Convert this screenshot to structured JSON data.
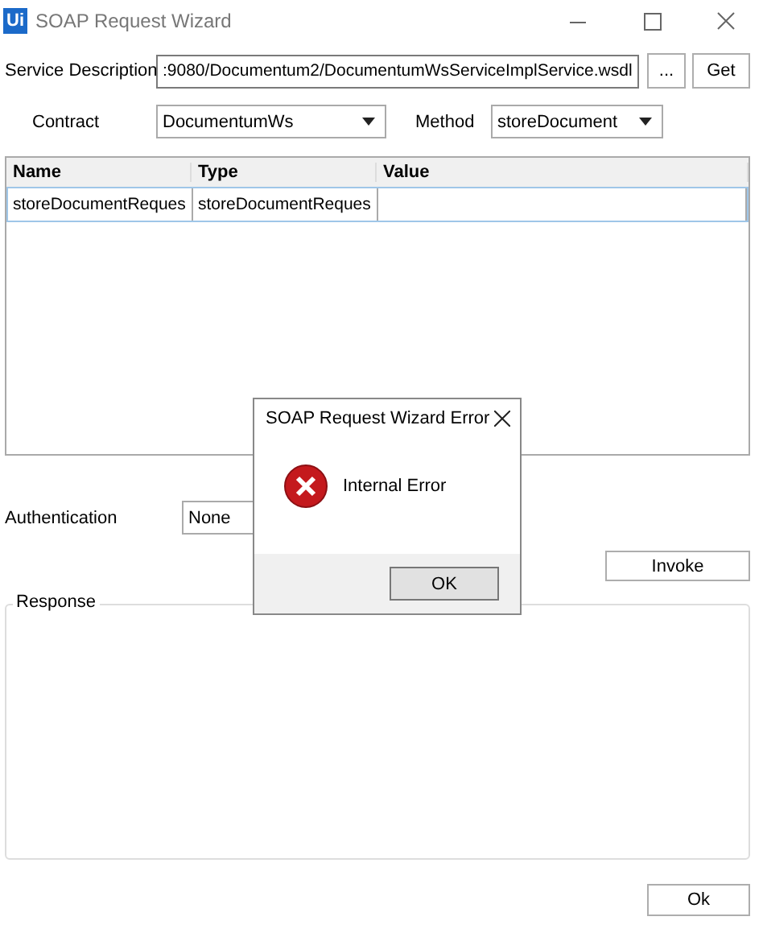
{
  "window": {
    "logo": "Ui",
    "title": "SOAP Request Wizard"
  },
  "service": {
    "label": "Service Description",
    "value": ":9080/Documentum2/DocumentumWsServiceImplService.wsdl",
    "browse": "...",
    "get": "Get"
  },
  "contract": {
    "label": "Contract",
    "value": "DocumentumWs"
  },
  "method": {
    "label": "Method",
    "value": "storeDocument"
  },
  "table": {
    "columns": [
      "Name",
      "Type",
      "Value"
    ],
    "rows": [
      {
        "cells": [
          "storeDocumentReques",
          "storeDocumentReques",
          ""
        ],
        "selected": true
      }
    ]
  },
  "authentication": {
    "label": "Authentication",
    "value": "None"
  },
  "invoke": "Invoke",
  "response": {
    "label": "Response"
  },
  "ok": "Ok",
  "dialog": {
    "title": "SOAP Request Wizard Error",
    "message": "Internal Error",
    "button": "OK"
  }
}
